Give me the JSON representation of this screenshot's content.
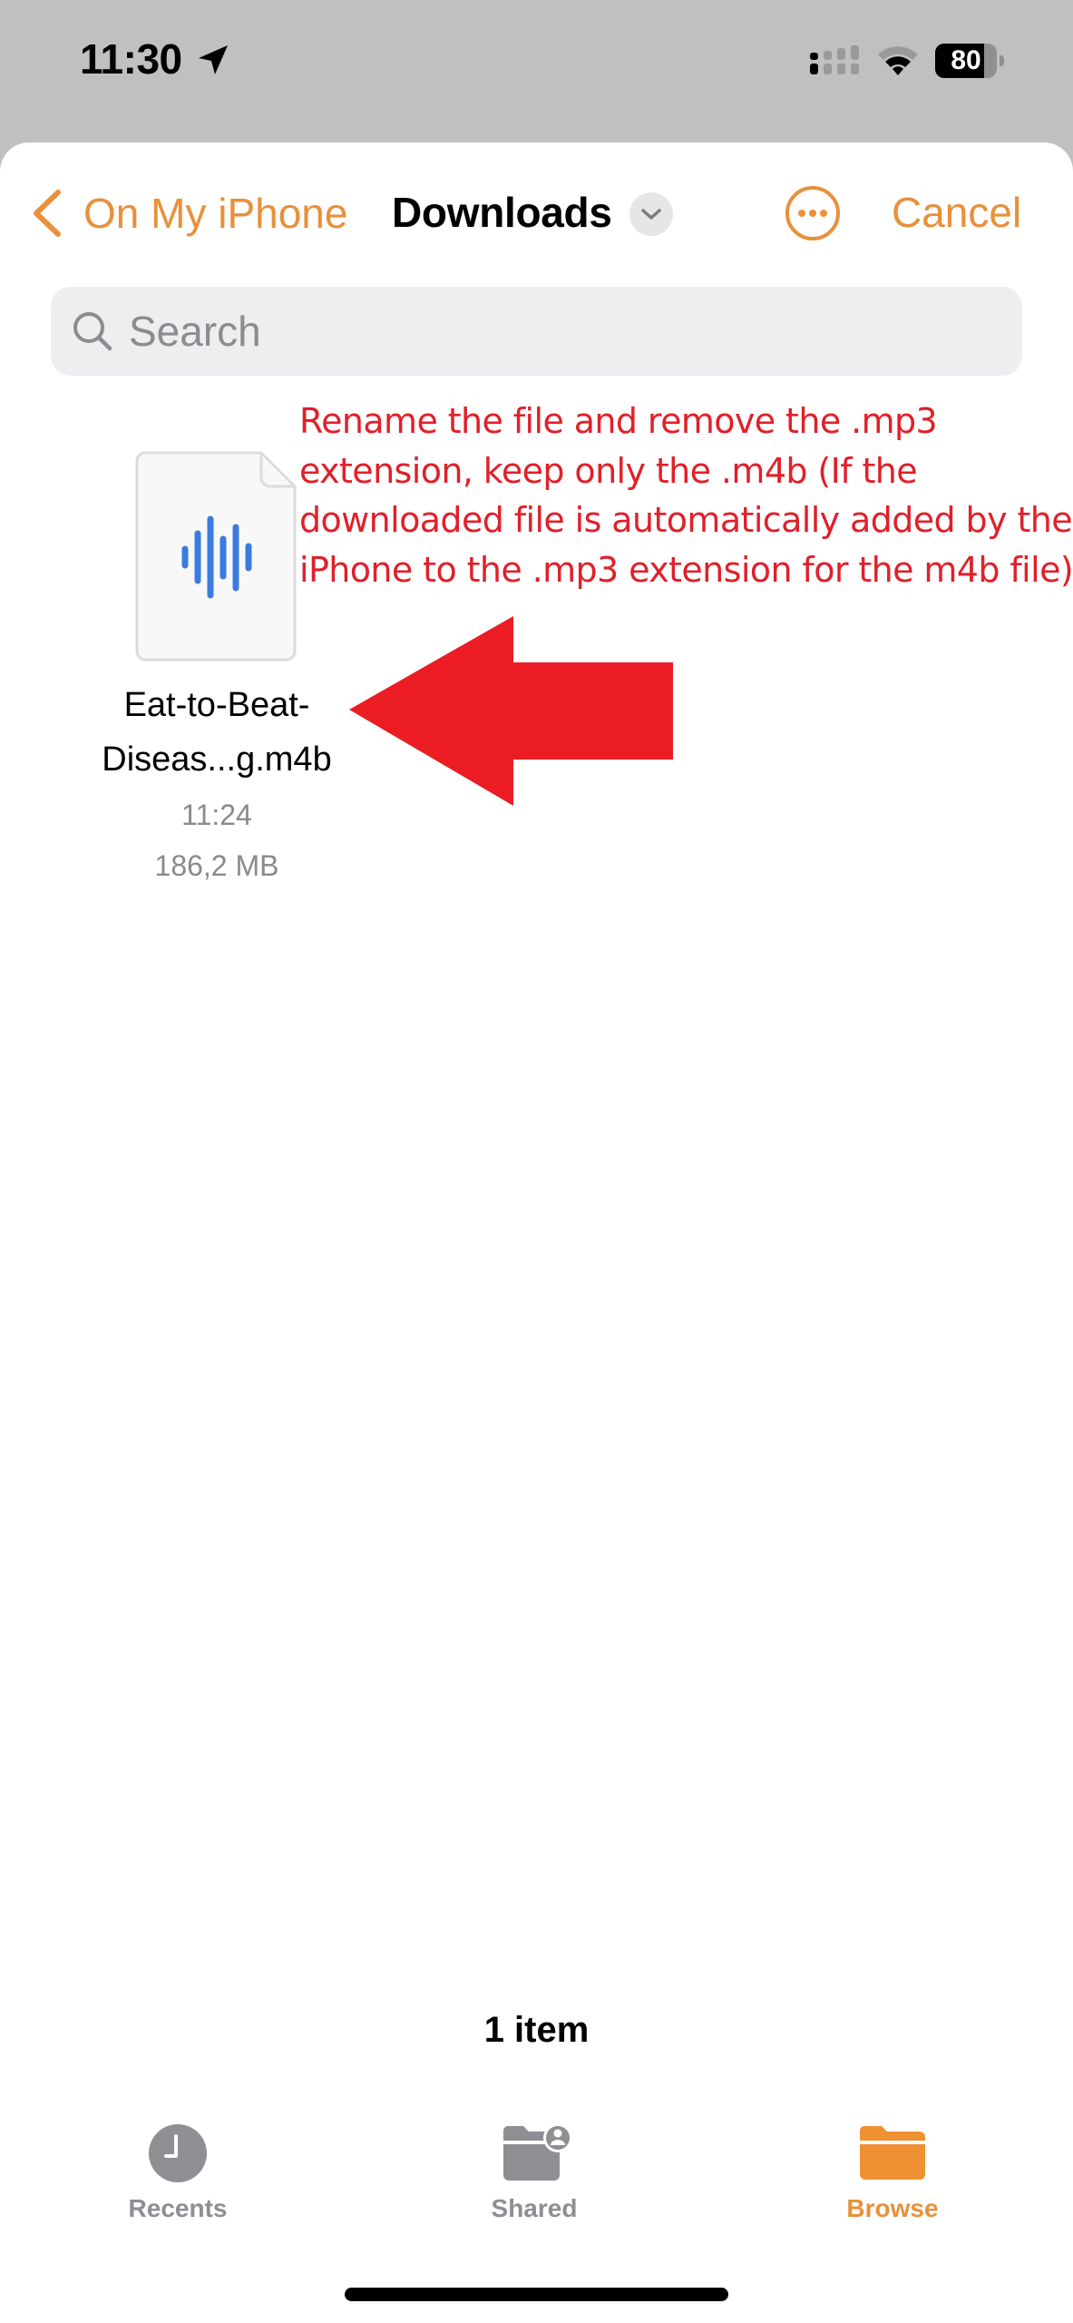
{
  "status_bar": {
    "time": "11:30",
    "location_icon": "location-arrow-icon",
    "signal_icon": "cellular-signal-icon",
    "wifi_icon": "wifi-icon",
    "battery_percent": "80"
  },
  "nav": {
    "back_label": "On My iPhone",
    "back_icon": "chevron-left-icon",
    "title": "Downloads",
    "title_menu_icon": "chevron-down-icon",
    "more_icon": "ellipsis-circle-icon",
    "cancel_label": "Cancel"
  },
  "search": {
    "placeholder": "Search",
    "value": "",
    "icon": "search-icon"
  },
  "files": [
    {
      "name_line1": "Eat-to-Beat-",
      "name_line2": "Diseas...g.m4b",
      "time": "11:24",
      "size": "186,2 MB",
      "icon": "audio-file-icon"
    }
  ],
  "annotation": {
    "lines": [
      "Rename the file and remove the .mp3",
      "extension, keep only the .m4b (If the",
      "downloaded file is automatically added by the",
      "iPhone to the .mp3 extension for the m4b file)"
    ],
    "arrow_icon": "arrow-left-icon",
    "color": "#e0202a"
  },
  "footer": {
    "item_count": "1 item"
  },
  "tabs": [
    {
      "label": "Recents",
      "icon": "clock-icon",
      "active": false
    },
    {
      "label": "Shared",
      "icon": "shared-folder-icon",
      "active": false
    },
    {
      "label": "Browse",
      "icon": "folder-icon",
      "active": true
    }
  ],
  "colors": {
    "accent": "#e8903a",
    "audio_wave": "#3a7be0",
    "inactive_tab": "#8e8e93"
  }
}
